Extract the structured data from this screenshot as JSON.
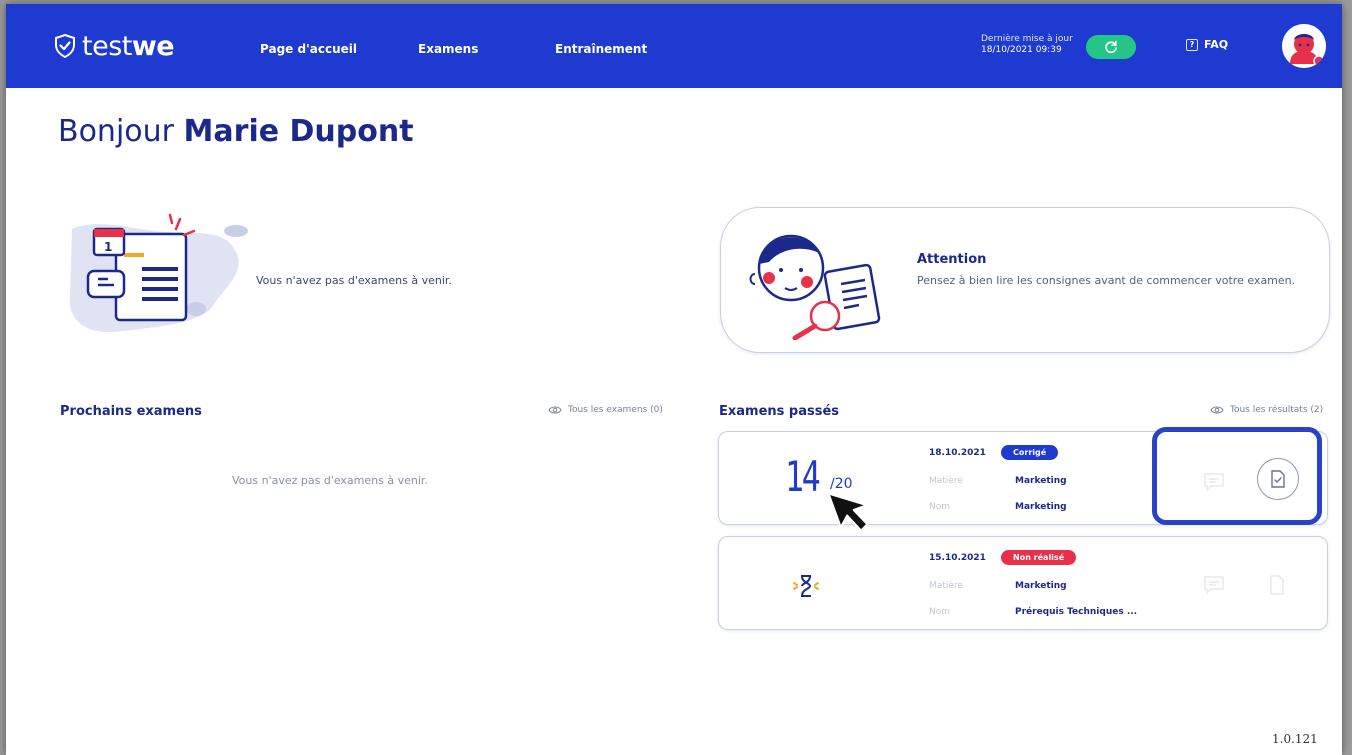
{
  "brand": {
    "name_prefix": "test",
    "name_bold": "we"
  },
  "nav": {
    "items": [
      {
        "label": "Page d'accueil"
      },
      {
        "label": "Examens"
      },
      {
        "label": "Entraînement"
      }
    ],
    "last_update_label": "Dernière mise à jour",
    "last_update_value": "18/10/2021 09:39",
    "faq_label": "FAQ"
  },
  "greeting": {
    "prefix": "Bonjour",
    "name": "Marie Dupont"
  },
  "upcoming_banner": {
    "text": "Vous n'avez pas d'examens à venir."
  },
  "attention": {
    "title": "Attention",
    "text": "Pensez à bien lire les consignes avant de commencer votre examen."
  },
  "upcoming": {
    "title": "Prochains examens",
    "see_all": "Tous les examens (0)",
    "empty_text": "Vous n'avez pas d'examens à venir."
  },
  "past": {
    "title": "Examens passés",
    "see_all": "Tous les résultats (2)",
    "items": [
      {
        "score": "14",
        "score_max": "/20",
        "date": "18.10.2021",
        "status": "Corrigé",
        "status_color": "#1f3ad0",
        "subject_label": "Matière",
        "subject": "Marketing",
        "name_label": "Nom",
        "name": "Marketing"
      },
      {
        "date": "15.10.2021",
        "status": "Non réalisé",
        "status_color": "#e8304a",
        "subject_label": "Matière",
        "subject": "Marketing",
        "name_label": "Nom",
        "name": "Prérequis Techniques ..."
      }
    ]
  },
  "version": "1.0.121",
  "colors": {
    "primary": "#1f3ad0",
    "accent_green": "#24c587",
    "accent_red": "#e8304a",
    "navy": "#1b2a8a"
  }
}
